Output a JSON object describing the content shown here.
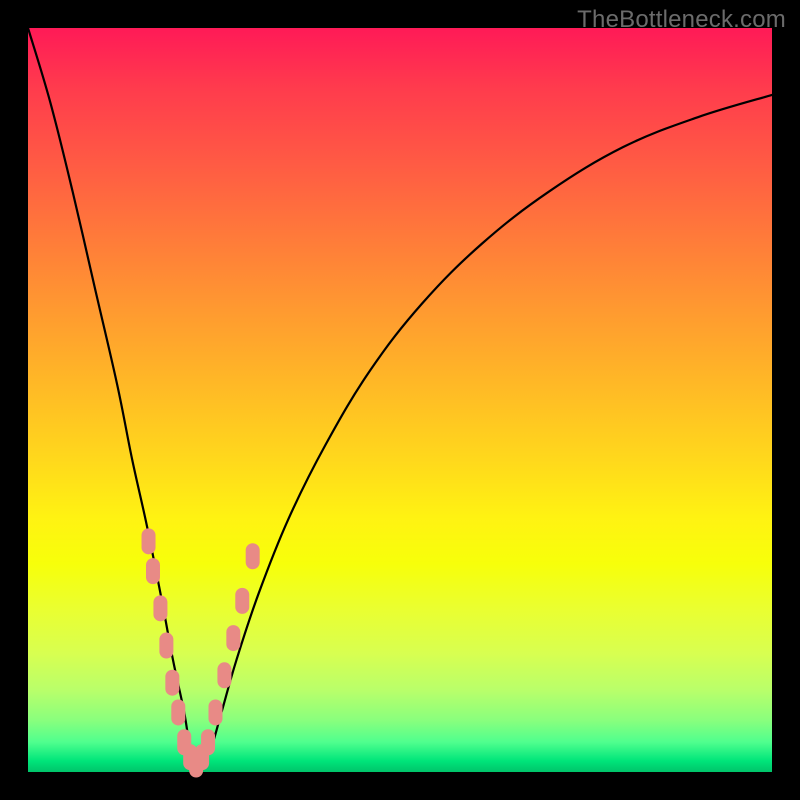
{
  "watermark": "TheBottleneck.com",
  "colors": {
    "frame_bg": "#000000",
    "watermark_text": "#6b6b6b",
    "curve": "#000000",
    "marker": "#e88a86",
    "gradient_top": "#ff1a57",
    "gradient_bottom": "#00c46a"
  },
  "chart_data": {
    "type": "line",
    "title": "",
    "xlabel": "",
    "ylabel": "",
    "xlim": [
      0,
      100
    ],
    "ylim": [
      0,
      100
    ],
    "legend": false,
    "grid": false,
    "notes": "V-shaped bottleneck curve over a red→green vertical heat gradient. Y≈0 = no bottleneck (green), Y≈100 = severe bottleneck (red). Minimum near x≈22. Salmon lozenge markers cluster along both arms near the valley.",
    "series": [
      {
        "name": "bottleneck_curve",
        "x": [
          0,
          3,
          6,
          9,
          12,
          14,
          16,
          18,
          19.5,
          21,
          22,
          23,
          24.5,
          26,
          28,
          31,
          35,
          40,
          46,
          53,
          61,
          70,
          80,
          90,
          100
        ],
        "values": [
          100,
          90,
          78,
          65,
          52,
          42,
          33,
          23,
          15,
          8,
          2,
          1,
          3,
          8,
          15,
          24,
          34,
          44,
          54,
          63,
          71,
          78,
          84,
          88,
          91
        ]
      }
    ],
    "markers": [
      {
        "x": 16.2,
        "y": 31
      },
      {
        "x": 16.8,
        "y": 27
      },
      {
        "x": 17.8,
        "y": 22
      },
      {
        "x": 18.6,
        "y": 17
      },
      {
        "x": 19.4,
        "y": 12
      },
      {
        "x": 20.2,
        "y": 8
      },
      {
        "x": 21.0,
        "y": 4
      },
      {
        "x": 21.8,
        "y": 2
      },
      {
        "x": 22.6,
        "y": 1
      },
      {
        "x": 23.4,
        "y": 2
      },
      {
        "x": 24.2,
        "y": 4
      },
      {
        "x": 25.2,
        "y": 8
      },
      {
        "x": 26.4,
        "y": 13
      },
      {
        "x": 27.6,
        "y": 18
      },
      {
        "x": 28.8,
        "y": 23
      },
      {
        "x": 30.2,
        "y": 29
      }
    ]
  }
}
